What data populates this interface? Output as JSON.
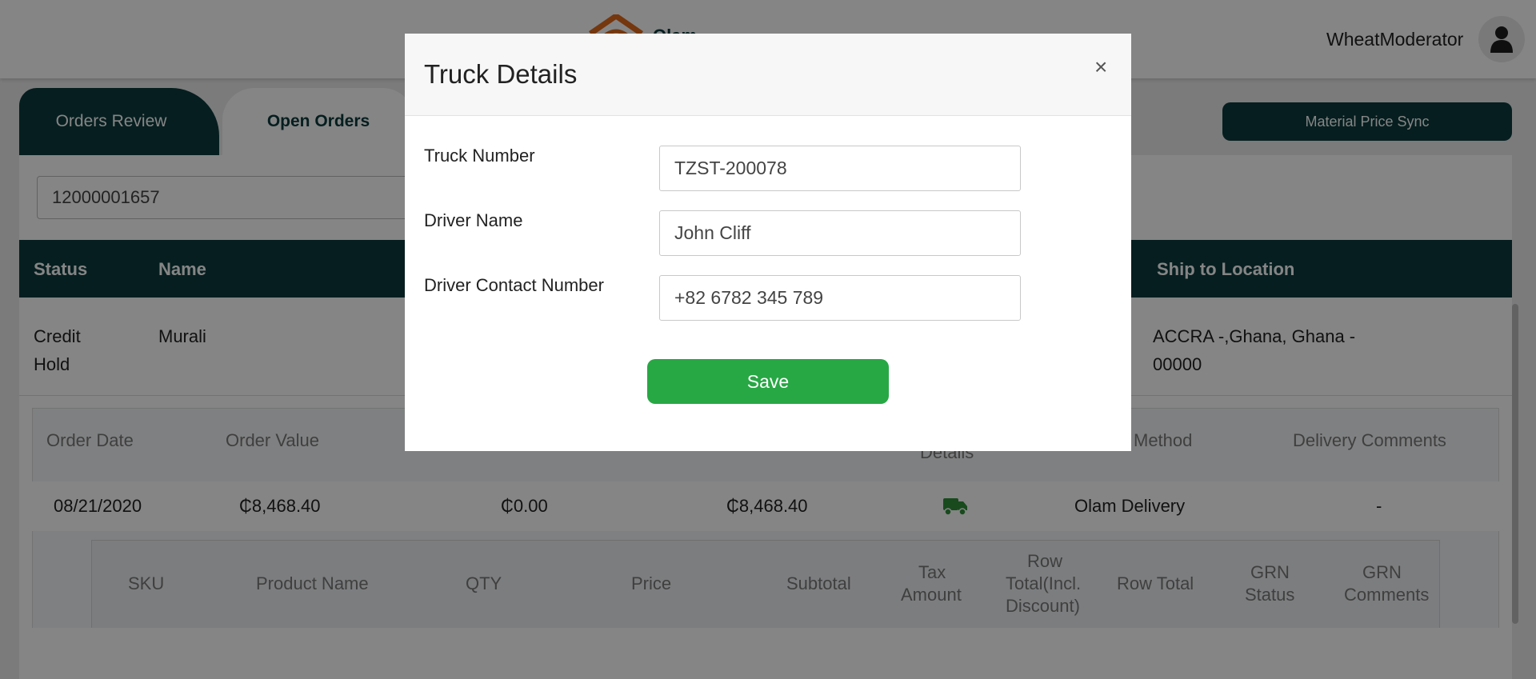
{
  "header": {
    "user_name": "WheatModerator",
    "logo_text": "Olam"
  },
  "tabs": [
    {
      "label": "Orders Review"
    },
    {
      "label": "Open Orders"
    }
  ],
  "actions": {
    "sync_label": "Material Price Sync"
  },
  "search": {
    "value": "12000001657"
  },
  "orders_table": {
    "columns": {
      "status": "Status",
      "name": "Name",
      "ship_to": "Ship to Location"
    },
    "row": {
      "status_line1": "Credit",
      "status_line2": "Hold",
      "name": "Murali",
      "ship_line1": "ACCRA -,Ghana, Ghana -",
      "ship_line2": "00000"
    }
  },
  "order_details": {
    "columns": {
      "order_date": "Order Date",
      "order_value": "Order Value",
      "details": "Details",
      "method": "Method",
      "delivery_comments": "Delivery Comments"
    },
    "row": {
      "order_date": "08/21/2020",
      "order_value": "₵8,468.40",
      "col3": "₵0.00",
      "col4": "₵8,468.40",
      "method": "Olam Delivery",
      "delivery_comments": "-"
    }
  },
  "items_table": {
    "columns": {
      "sku": "SKU",
      "product_name": "Product Name",
      "qty": "QTY",
      "price": "Price",
      "subtotal": "Subtotal",
      "tax_amount_1": "Tax",
      "tax_amount_2": "Amount",
      "row_total_incl_1": "Row",
      "row_total_incl_2": "Total(Incl.",
      "row_total_incl_3": "Discount)",
      "row_total": "Row Total",
      "grn_status_1": "GRN",
      "grn_status_2": "Status",
      "grn_comments_1": "GRN",
      "grn_comments_2": "Comments"
    }
  },
  "modal": {
    "title": "Truck Details",
    "close_glyph": "×",
    "fields": {
      "truck_number": {
        "label": "Truck Number",
        "value": "TZST-200078"
      },
      "driver_name": {
        "label": "Driver Name",
        "value": "John Cliff"
      },
      "driver_contact": {
        "label": "Driver Contact Number",
        "value": "+82 6782 345 789"
      }
    },
    "save_label": "Save"
  },
  "colors": {
    "primary": "#0c3a3d",
    "success": "#28a745",
    "truck_icon": "#2f8f3a",
    "logo_accent": "#e06a1b"
  },
  "icons": {
    "avatar": "user-icon",
    "truck": "truck-icon",
    "close": "close-icon"
  }
}
